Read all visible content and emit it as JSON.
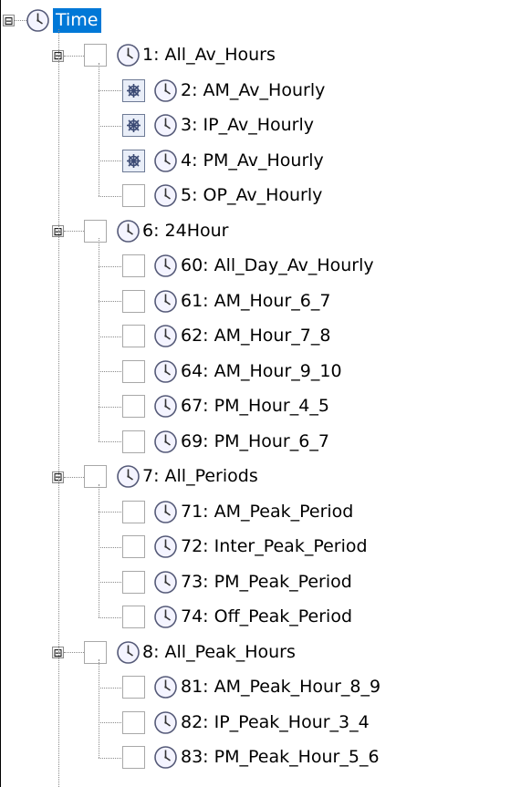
{
  "tree": {
    "root": {
      "label": "Time",
      "expander": "⊟",
      "selected": true
    },
    "groups": [
      {
        "label": "1: All_Av_Hours",
        "children": [
          {
            "label": "2: AM_Av_Hourly",
            "state": "partial"
          },
          {
            "label": "3: IP_Av_Hourly",
            "state": "partial"
          },
          {
            "label": "4: PM_Av_Hourly",
            "state": "partial"
          },
          {
            "label": "5: OP_Av_Hourly",
            "state": "unchecked"
          }
        ]
      },
      {
        "label": "6: 24Hour",
        "children": [
          {
            "label": "60: All_Day_Av_Hourly",
            "state": "unchecked"
          },
          {
            "label": "61: AM_Hour_6_7",
            "state": "unchecked"
          },
          {
            "label": "62: AM_Hour_7_8",
            "state": "unchecked"
          },
          {
            "label": "64: AM_Hour_9_10",
            "state": "unchecked"
          },
          {
            "label": "67: PM_Hour_4_5",
            "state": "unchecked"
          },
          {
            "label": "69: PM_Hour_6_7",
            "state": "unchecked"
          }
        ]
      },
      {
        "label": "7: All_Periods",
        "children": [
          {
            "label": "71: AM_Peak_Period",
            "state": "unchecked"
          },
          {
            "label": "72: Inter_Peak_Period",
            "state": "unchecked"
          },
          {
            "label": "73: PM_Peak_Period",
            "state": "unchecked"
          },
          {
            "label": "74: Off_Peak_Period",
            "state": "unchecked"
          }
        ]
      },
      {
        "label": "8: All_Peak_Hours",
        "children": [
          {
            "label": "81: AM_Peak_Hour_8_9",
            "state": "unchecked"
          },
          {
            "label": "82: IP_Peak_Hour_3_4",
            "state": "unchecked"
          },
          {
            "label": "83: PM_Peak_Hour_5_6",
            "state": "unchecked"
          }
        ]
      }
    ]
  },
  "colors": {
    "selection": "#0078d7",
    "clock_face": "#f4f4ff",
    "clock_border": "#555a78"
  }
}
